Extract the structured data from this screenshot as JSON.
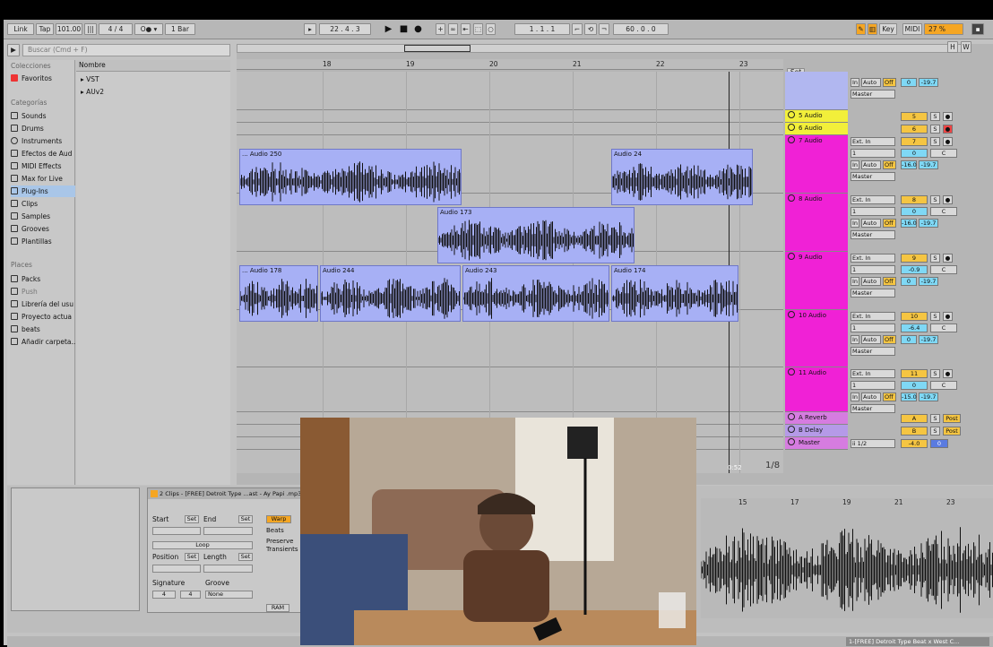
{
  "control_bar": {
    "link": "Link",
    "tap": "Tap",
    "tempo": "101.00",
    "signature": "4 / 4",
    "quantize": "1 Bar",
    "position": "22 . 4 . 3",
    "loop_start": "1 . 1 . 1",
    "loop_length": "60 . 0 . 0",
    "key": "Key",
    "midi": "MIDI",
    "cpu": "27 %",
    "h": "H",
    "w": "W"
  },
  "browser": {
    "search_placeholder": "Buscar (Cmd + F)",
    "collections_title": "Colecciones",
    "favorites": "Favoritos",
    "categories_title": "Categorías",
    "categories": [
      "Sounds",
      "Drums",
      "Instruments",
      "Efectos de Aud",
      "MIDI Effects",
      "Max for Live",
      "Plug-Ins",
      "Clips",
      "Samples",
      "Grooves",
      "Plantillas"
    ],
    "places_title": "Places",
    "places": [
      "Packs",
      "Push",
      "Librería del usu",
      "Proyecto actua",
      "beats",
      "Añadir carpeta..."
    ],
    "column_name": "Nombre",
    "files": [
      "VST",
      "AUv2"
    ]
  },
  "arrangement": {
    "ruler": [
      "18",
      "19",
      "20",
      "21",
      "22",
      "23"
    ],
    "set_label": "Set",
    "time_label": "0:52",
    "page_label": "1/8",
    "clips": [
      {
        "name": "... Audio 250",
        "lane": 0
      },
      {
        "name": "Audio 24",
        "lane": 0
      },
      {
        "name": "Audio 173",
        "lane": 1
      },
      {
        "name": "... Audio 178",
        "lane": 2
      },
      {
        "name": "Audio 244",
        "lane": 2
      },
      {
        "name": "Audio 243",
        "lane": 2
      },
      {
        "name": "Audio 174",
        "lane": 2
      }
    ]
  },
  "mixer": {
    "top": {
      "in": "In",
      "auto": "Auto",
      "off": "Off",
      "vol": "0",
      "pan": "-19.7",
      "out": "Master"
    },
    "tracks": [
      {
        "name": "5 Audio",
        "num": "5",
        "s": "S"
      },
      {
        "name": "6 Audio",
        "num": "6",
        "s": "S"
      },
      {
        "name": "7 Audio",
        "num": "7",
        "s": "S",
        "input": "Ext. In",
        "ch": "1",
        "vol": "0",
        "pan": "C",
        "send": "-16.0",
        "send2": "-19.7",
        "out": "Master"
      },
      {
        "name": "8 Audio",
        "num": "8",
        "s": "S",
        "input": "Ext. In",
        "ch": "1",
        "vol": "0",
        "pan": "C",
        "send": "-16.0",
        "send2": "-19.7",
        "out": "Master"
      },
      {
        "name": "9 Audio",
        "num": "9",
        "s": "S",
        "input": "Ext. In",
        "ch": "1",
        "vol": "-0.9",
        "pan": "C",
        "send": "0",
        "send2": "-19.7",
        "out": "Master"
      },
      {
        "name": "10 Audio",
        "num": "10",
        "s": "S",
        "input": "Ext. In",
        "ch": "1",
        "vol": "-6.4",
        "pan": "C",
        "send": "0",
        "send2": "-19.7",
        "out": "Master"
      },
      {
        "name": "11 Audio",
        "num": "11",
        "s": "S",
        "input": "Ext. In",
        "ch": "1",
        "vol": "0",
        "pan": "C",
        "send": "-15.0",
        "send2": "-19.7",
        "out": "Master"
      }
    ],
    "returns": [
      {
        "name": "A Reverb",
        "num": "A",
        "s": "S",
        "post": "Post"
      },
      {
        "name": "B Delay",
        "num": "B",
        "s": "S",
        "post": "Post"
      },
      {
        "name": "Master",
        "num": "0",
        "out": "ii 1/2",
        "vol": "-4.0"
      }
    ],
    "in": "In",
    "auto": "Auto",
    "off": "Off"
  },
  "detail": {
    "clip_title": "2 Clips - [FREE] Detroit Type ...ast - Ay Papi .mp3",
    "start": "Start",
    "end": "End",
    "set": "Set",
    "loop": "Loop",
    "position": "Position",
    "length": "Length",
    "signature": "Signature",
    "sig_num": "4",
    "sig_den": "4",
    "groove": "Groove",
    "groove_val": "None",
    "warp": "Warp",
    "beats": "Beats",
    "preserve": "Preserve",
    "transients": "Transients",
    "ram": "RAM",
    "ruler": [
      "15",
      "17",
      "19",
      "21",
      "23"
    ]
  },
  "status": {
    "track_info": "1-[FREE] Detroit Type Beat x West C..."
  }
}
